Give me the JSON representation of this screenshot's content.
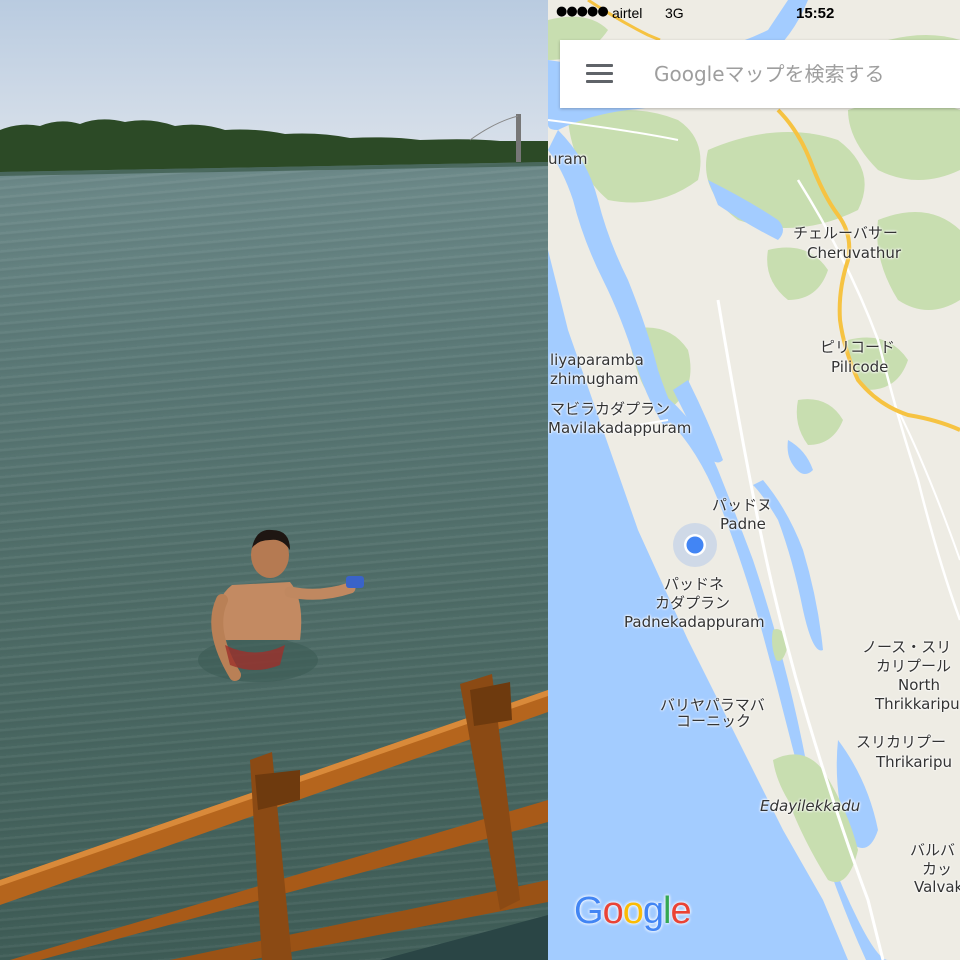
{
  "status_bar": {
    "signal": "●●●●●",
    "carrier": "airtel",
    "network": "3G",
    "time": "15:52"
  },
  "search": {
    "placeholder": "Googleマップを検索する"
  },
  "icons": {
    "menu": "hamburger-menu-icon",
    "location": "my-location-dot-icon"
  },
  "map_labels": {
    "cheruvathur_jp": "チェルーバサー",
    "cheruvathur": "Cheruvathur",
    "pilicode_jp": "ピリコード",
    "pilicode": "Pilicode",
    "uram": "uram",
    "iliyaparamba": "liyaparamba",
    "ezhimugham": "zhimugham",
    "mavilakadappuram_jp": "マビラカダプラン",
    "mavilakadappuram": "Mavilakadappuram",
    "padne_jp": "パッドヌ",
    "padne": "Padne",
    "padnekadappuram_jp1": "パッドネ",
    "padnekadappuram_jp2": "カダプラン",
    "padnekadappuram": "Padnekadappuram",
    "north_thrikkaripur_jp1": "ノース・スリ",
    "north_thrikkaripur_jp2": "カリプール",
    "north": "North",
    "north_thrikkaripur": "Thrikkaripu",
    "valiyaparamba_jp1": "バリヤパラマバ",
    "valiyaparamba_jp2": "コーニック",
    "thrikaripur_jp": "スリカリプー",
    "thrikaripur": "Thrikaripu",
    "edayilekkadu": "Edayilekkadu",
    "valiyaparamba_right_jp1": "バルバ",
    "valiyaparamba_right_jp2": "カッ",
    "valvak": "Valvak"
  },
  "google_logo": {
    "letters": [
      "G",
      "o",
      "o",
      "g",
      "l",
      "e"
    ],
    "colors": [
      "#4285F4",
      "#EA4335",
      "#FBBC05",
      "#4285F4",
      "#34A853",
      "#EA4335"
    ]
  },
  "colors": {
    "water": "#a3ccff",
    "land": "#eeece4",
    "park": "#c8deb0",
    "highway": "#f6c342",
    "location_dot": "#4285F4"
  }
}
